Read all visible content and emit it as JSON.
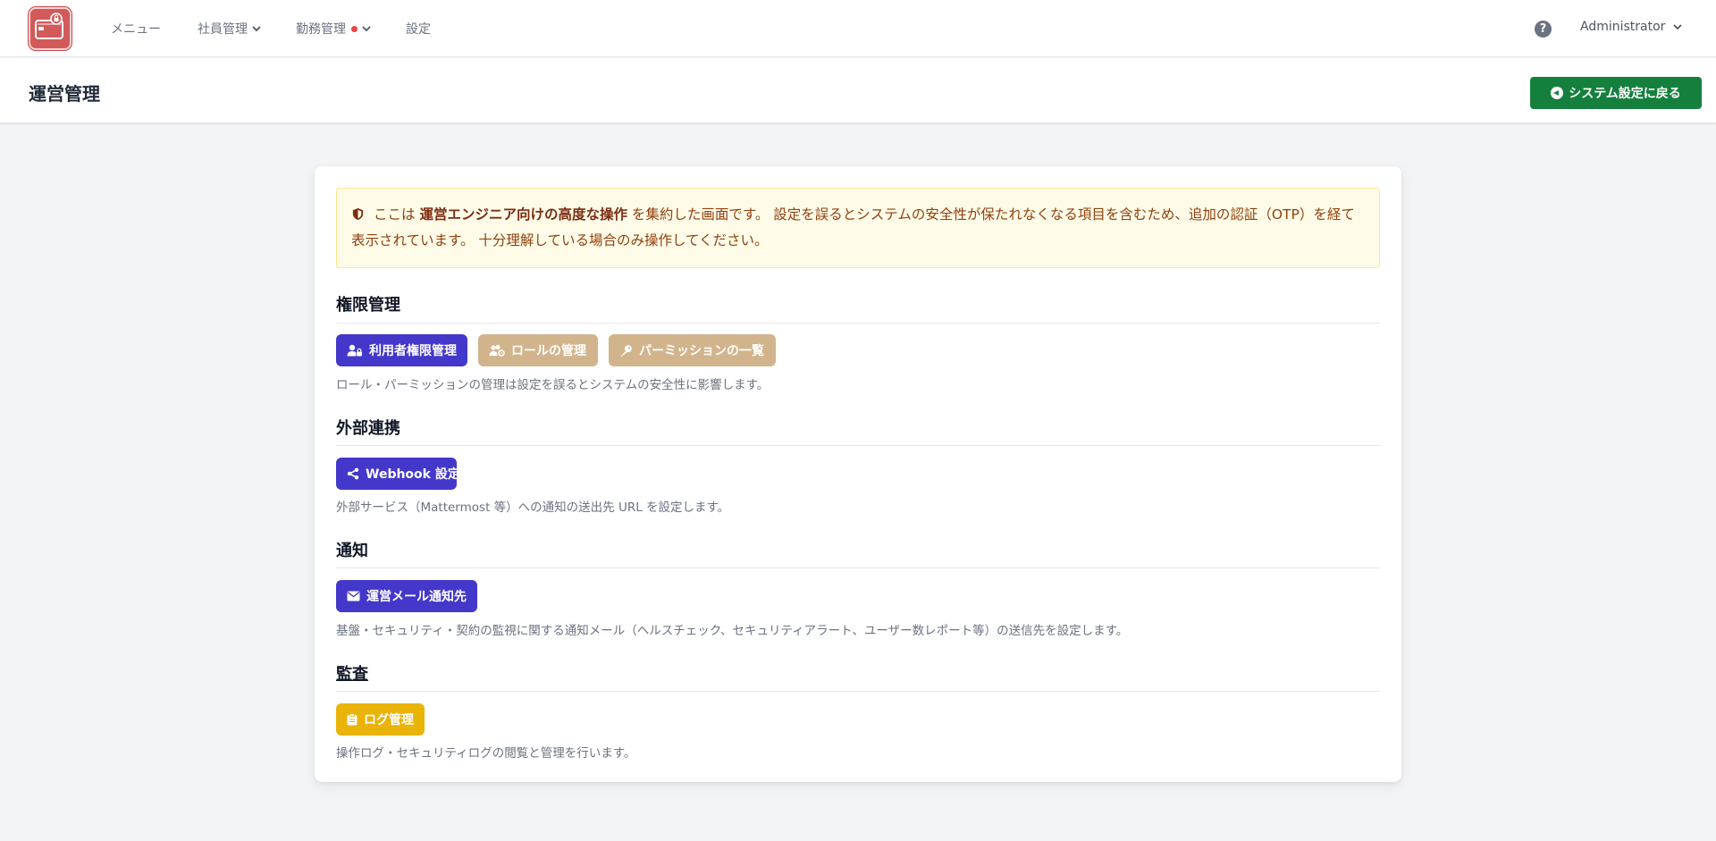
{
  "navbar": {
    "menu_label": "メニュー",
    "employee_label": "社員管理",
    "attendance_label": "勤務管理",
    "settings_label": "設定",
    "user_label": "Administrator",
    "help_label": "?"
  },
  "header": {
    "title": "運営管理",
    "back_button_label": "システム設定に戻る"
  },
  "alert": {
    "prefix": "ここは",
    "emphasis": "運営エンジニア向けの高度な操作",
    "suffix": "を集約した画面です。 設定を誤るとシステムの安全性が保たれなくなる項目を含むため、追加の認証（OTP）を経て表示されています。 十分理解している場合のみ操作してください。"
  },
  "sections": [
    {
      "title": "権限管理",
      "buttons": [
        {
          "label": "利用者権限管理",
          "icon": "user-lock-icon"
        },
        {
          "label": "ロールの管理",
          "icon": "users-cog-icon"
        },
        {
          "label": "パーミッションの一覧",
          "icon": "key-icon"
        }
      ],
      "description": "ロール・パーミッションの管理は設定を誤るとシステムの安全性に影響します。"
    },
    {
      "title": "外部連携",
      "buttons": [
        {
          "label": "Webhook 設定",
          "icon": "share-icon"
        }
      ],
      "description": "外部サービス（Mattermost 等）への通知の送出先 URL を設定します。"
    },
    {
      "title": "通知",
      "buttons": [
        {
          "label": "運営メール通知先",
          "icon": "envelope-icon"
        }
      ],
      "description": "基盤・セキュリティ・契約の監視に関する通知メール（ヘルスチェック、セキュリティアラート、ユーザー数レポート等）の送信先を設定します。"
    },
    {
      "title": "監査",
      "buttons": [
        {
          "label": "ログ管理",
          "icon": "clipboard-icon"
        }
      ],
      "description": "操作ログ・セキュリティログの閲覧と管理を行います。"
    }
  ],
  "colors": {
    "primary": "#4338ca",
    "secondary": "#d2b48c",
    "warning": "#eab308",
    "success": "#15803d",
    "alert_bg": "#fefce8",
    "alert_text": "#92400e",
    "logo": "#d25a5a"
  }
}
